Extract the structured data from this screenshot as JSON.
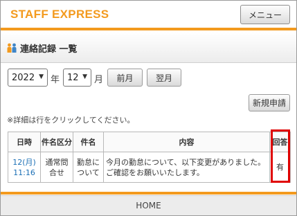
{
  "header": {
    "logo": "STAFF EXPRESS",
    "menu_label": "メニュー"
  },
  "section": {
    "icon": "people-icon",
    "title": "連絡記録 一覧"
  },
  "filters": {
    "year_value": "2022",
    "year_suffix": "年",
    "month_value": "12",
    "month_suffix": "月",
    "prev_label": "前月",
    "next_label": "翌月"
  },
  "new_request_label": "新規申請",
  "hint": "※詳細は行をクリックしてください。",
  "table": {
    "headers": [
      "日時",
      "件名区分",
      "件名",
      "内容",
      "回答"
    ],
    "rows": [
      {
        "date": "12(月)",
        "time": "11:16",
        "category_1": "通常問",
        "category_2": "合せ",
        "subject_1": "勤怠に",
        "subject_2": "ついて",
        "content_1": "今月の勤怠について、以下変更がありました。",
        "content_2": "ご確認をお願いいたします。",
        "answer": "有"
      }
    ]
  },
  "footer": {
    "home_label": "HOME"
  },
  "colors": {
    "brand": "#f39a1e",
    "link": "#1b6fb5",
    "highlight": "#e00000"
  }
}
